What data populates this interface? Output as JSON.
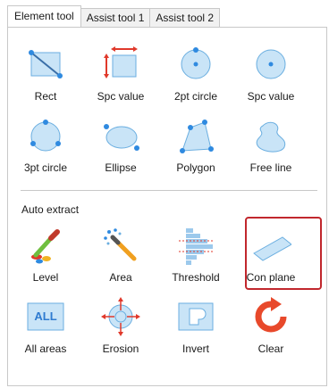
{
  "tabs": [
    "Element tool",
    "Assist tool 1",
    "Assist tool 2"
  ],
  "element_tools": [
    {
      "label": "Rect",
      "icon": "rect-icon"
    },
    {
      "label": "Spc value",
      "icon": "spc-value-icon"
    },
    {
      "label": "2pt circle",
      "icon": "two-point-circle-icon"
    },
    {
      "label": "Spc value",
      "icon": "spc-value-circle-icon"
    },
    {
      "label": "3pt circle",
      "icon": "three-point-circle-icon"
    },
    {
      "label": "Ellipse",
      "icon": "ellipse-icon"
    },
    {
      "label": "Polygon",
      "icon": "polygon-icon"
    },
    {
      "label": "Free line",
      "icon": "free-line-icon"
    }
  ],
  "auto_extract": {
    "title": "Auto extract",
    "tools": [
      {
        "label": "Level",
        "icon": "level-dropper-icon"
      },
      {
        "label": "Area",
        "icon": "area-wand-icon"
      },
      {
        "label": "Threshold",
        "icon": "threshold-icon"
      },
      {
        "label": "Con plane",
        "icon": "con-plane-icon",
        "highlighted": true
      },
      {
        "label": "All areas",
        "icon": "all-areas-icon",
        "badge": "ALL"
      },
      {
        "label": "Erosion",
        "icon": "erosion-icon"
      },
      {
        "label": "Invert",
        "icon": "invert-icon"
      },
      {
        "label": "Clear",
        "icon": "clear-icon"
      }
    ]
  },
  "colors": {
    "shape_fill": "#c9e4f7",
    "shape_stroke": "#6aaee0",
    "handle": "#2f8ae0",
    "arrow_red": "#e0392b",
    "highlight": "#c1272d"
  }
}
